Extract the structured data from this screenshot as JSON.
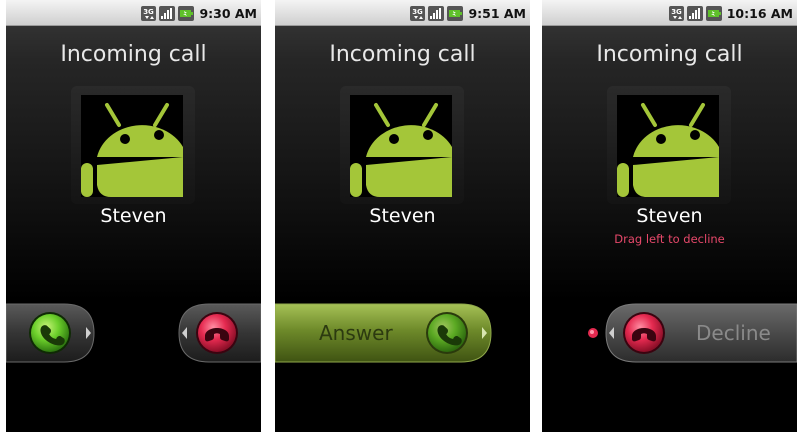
{
  "screens": [
    {
      "status": {
        "time": "9:30 AM"
      },
      "title": "Incoming call",
      "caller": "Steven",
      "hint": ""
    },
    {
      "status": {
        "time": "9:51 AM"
      },
      "title": "Incoming call",
      "caller": "Steven",
      "hint": "",
      "answer_label": "Answer"
    },
    {
      "status": {
        "time": "10:16 AM"
      },
      "title": "Incoming call",
      "caller": "Steven",
      "hint": "Drag left to decline",
      "decline_label": "Decline"
    }
  ],
  "icons": {
    "network": "3g-icon",
    "signal": "signal-bars-icon",
    "battery": "battery-icon",
    "answer": "phone-answer-icon",
    "decline": "phone-hangup-icon",
    "avatar": "android-robot-icon"
  },
  "colors": {
    "answer_green": "#6ccf2b",
    "decline_red": "#e52a50",
    "android_green": "#a4c639",
    "hint_red": "#e6486a"
  }
}
